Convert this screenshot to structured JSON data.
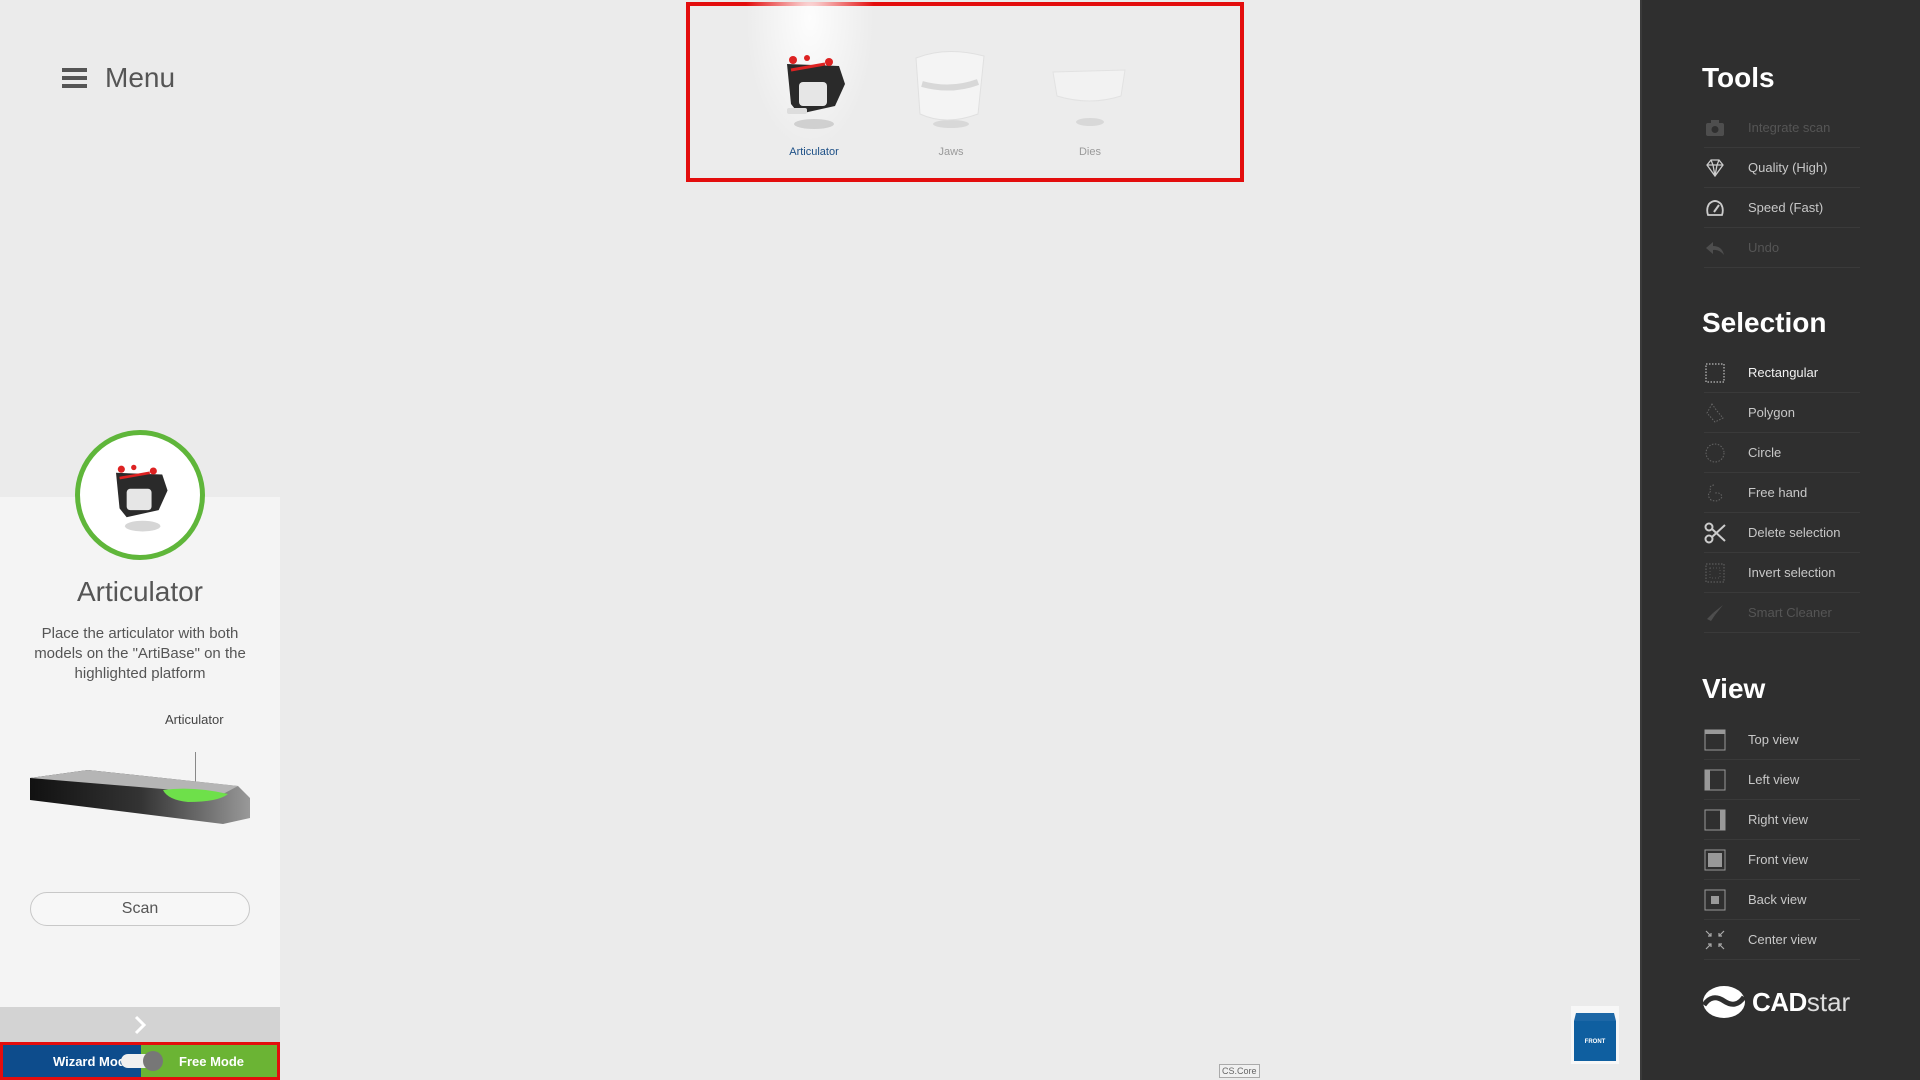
{
  "menu": {
    "label": "Menu"
  },
  "object_picker": {
    "items": [
      {
        "label": "Articulator",
        "active": true
      },
      {
        "label": "Jaws",
        "active": false
      },
      {
        "label": "Dies",
        "active": false
      }
    ]
  },
  "wizard": {
    "title": "Articulator",
    "description": "Place the articulator with both models on the \"ArtiBase\" on the highlighted platform",
    "platform_label": "Articulator",
    "scan_label": "Scan"
  },
  "mode_switch": {
    "left_label": "Wizard Mode",
    "right_label": "Free Mode",
    "selected": "Free Mode"
  },
  "viewport": {
    "cs_label": "CS.Core",
    "cube_face": "FRONT"
  },
  "right_panel": {
    "tools": {
      "title": "Tools",
      "items": [
        {
          "label": "Integrate scan",
          "icon": "camera-icon",
          "state": "disabled"
        },
        {
          "label": "Quality (High)",
          "icon": "diamond-icon",
          "state": "normal"
        },
        {
          "label": "Speed (Fast)",
          "icon": "speedometer-icon",
          "state": "normal"
        },
        {
          "label": "Undo",
          "icon": "undo-icon",
          "state": "disabled"
        }
      ]
    },
    "selection": {
      "title": "Selection",
      "items": [
        {
          "label": "Rectangular",
          "icon": "rect-select-icon",
          "state": "active"
        },
        {
          "label": "Polygon",
          "icon": "polygon-select-icon",
          "state": "normal"
        },
        {
          "label": "Circle",
          "icon": "circle-select-icon",
          "state": "normal"
        },
        {
          "label": "Free hand",
          "icon": "freehand-select-icon",
          "state": "normal"
        },
        {
          "label": "Delete selection",
          "icon": "scissors-icon",
          "state": "normal"
        },
        {
          "label": "Invert selection",
          "icon": "invert-select-icon",
          "state": "normal"
        },
        {
          "label": "Smart Cleaner",
          "icon": "brush-icon",
          "state": "disabled"
        }
      ]
    },
    "view": {
      "title": "View",
      "items": [
        {
          "label": "Top view",
          "icon": "top-view-icon",
          "state": "normal"
        },
        {
          "label": "Left view",
          "icon": "left-view-icon",
          "state": "normal"
        },
        {
          "label": "Right view",
          "icon": "right-view-icon",
          "state": "normal"
        },
        {
          "label": "Front view",
          "icon": "front-view-icon",
          "state": "normal"
        },
        {
          "label": "Back view",
          "icon": "back-view-icon",
          "state": "normal"
        },
        {
          "label": "Center view",
          "icon": "center-view-icon",
          "state": "normal"
        }
      ]
    },
    "logo": {
      "bold": "CAD",
      "light": "star"
    }
  },
  "colors": {
    "accent_green": "#5fb63a",
    "wizard_blue": "#0d4c8c",
    "free_green": "#6bb434",
    "highlight_red": "#e30d0d",
    "panel_dark": "#2f2f2f",
    "active_caption": "#1c4f86"
  }
}
